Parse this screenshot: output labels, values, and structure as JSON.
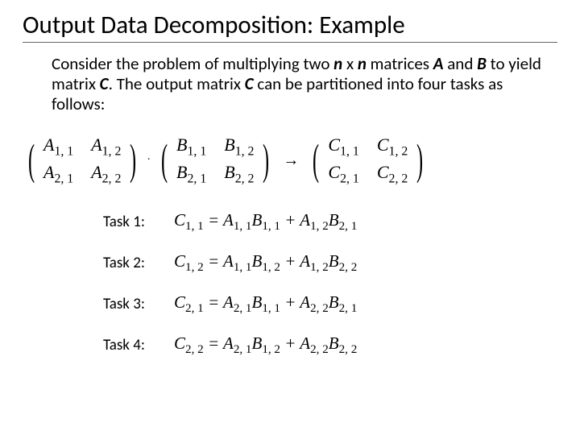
{
  "title": "Output Data Decomposition: Example",
  "intro": {
    "p1a": "Consider the problem of multiplying two ",
    "n1": "n",
    "x": " x ",
    "n2": "n",
    "p1b": " matrices ",
    "A": "A",
    "p2a": " and ",
    "B": "B",
    "p2b": " to yield matrix ",
    "C": "C",
    "p2c": ". The output matrix ",
    "C2": "C",
    "p2d": " can be partitioned into four tasks as follows:"
  },
  "matrixA": {
    "r1c1": "A",
    "s11": "1, 1",
    "r1c2": "A",
    "s12": "1, 2",
    "r2c1": "A",
    "s21": "2, 1",
    "r2c2": "A",
    "s22": "2, 2"
  },
  "matrixB": {
    "r1c1": "B",
    "s11": "1, 1",
    "r1c2": "B",
    "s12": "1, 2",
    "r2c1": "B",
    "s21": "2, 1",
    "r2c2": "B",
    "s22": "2, 2"
  },
  "matrixC": {
    "r1c1": "C",
    "s11": "1, 1",
    "r1c2": "C",
    "s12": "1, 2",
    "r2c1": "C",
    "s21": "2, 1",
    "r2c2": "C",
    "s22": "2, 2"
  },
  "dot": "·",
  "arrow": "→",
  "tasks": {
    "t1": {
      "label": "Task 1:",
      "lhs": "C",
      "lsub": "1, 1",
      "eq": " = ",
      "a1": "A",
      "a1s": "1, 1",
      "b1": "B",
      "b1s": "1, 1",
      "plus": " + ",
      "a2": "A",
      "a2s": "1, 2",
      "b2": "B",
      "b2s": "2, 1"
    },
    "t2": {
      "label": "Task 2:",
      "lhs": "C",
      "lsub": "1, 2",
      "eq": " = ",
      "a1": "A",
      "a1s": "1, 1",
      "b1": "B",
      "b1s": "1, 2",
      "plus": " + ",
      "a2": "A",
      "a2s": "1, 2",
      "b2": "B",
      "b2s": "2, 2"
    },
    "t3": {
      "label": "Task 3:",
      "lhs": "C",
      "lsub": "2, 1",
      "eq": " = ",
      "a1": "A",
      "a1s": "2, 1",
      "b1": "B",
      "b1s": "1, 1",
      "plus": " + ",
      "a2": "A",
      "a2s": "2, 2",
      "b2": "B",
      "b2s": "2, 1"
    },
    "t4": {
      "label": "Task 4:",
      "lhs": "C",
      "lsub": "2, 2",
      "eq": " = ",
      "a1": "A",
      "a1s": "2, 1",
      "b1": "B",
      "b1s": "1, 2",
      "plus": " + ",
      "a2": "A",
      "a2s": "2, 2",
      "b2": "B",
      "b2s": "2, 2"
    }
  }
}
